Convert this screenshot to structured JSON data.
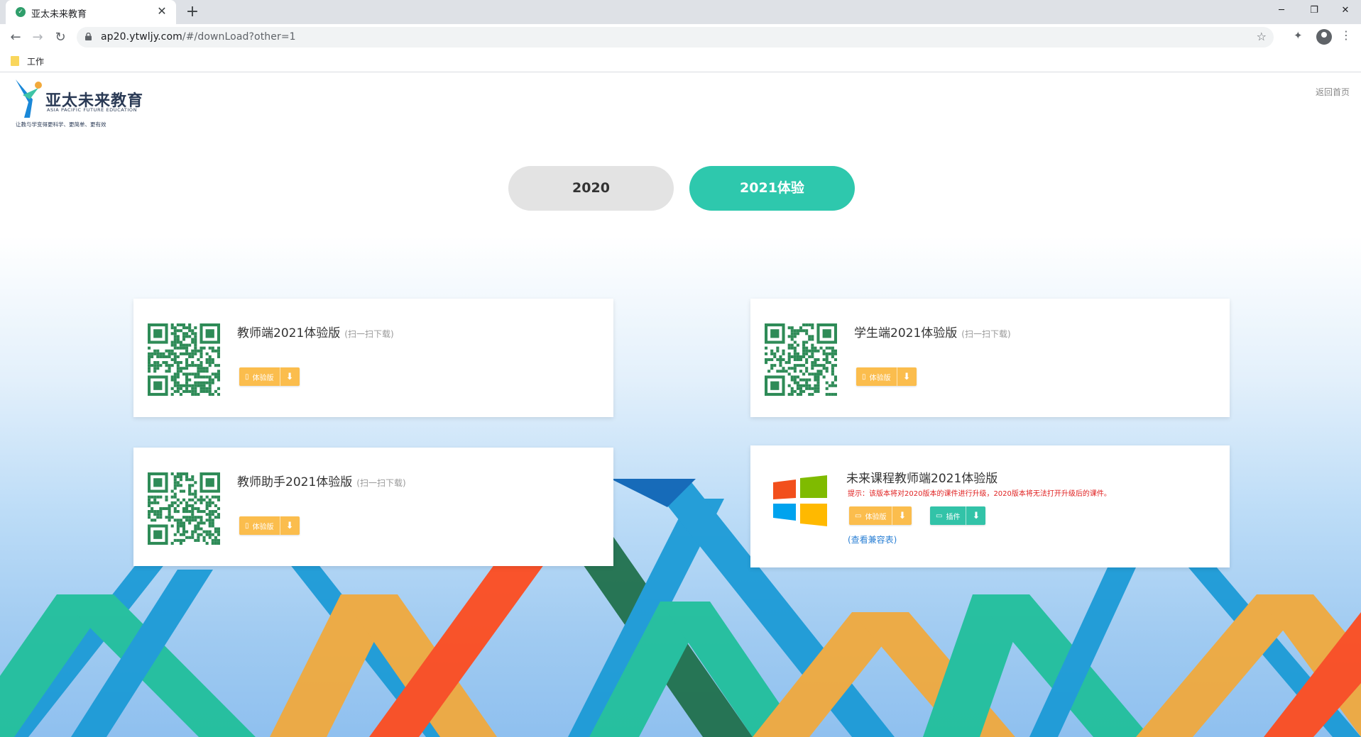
{
  "browser": {
    "tab_title": "亚太未来教育",
    "tab_close": "✕",
    "new_tab": "+",
    "url_host": "ap20.ytwljy.com",
    "url_path": "/#/downLoad?other=1",
    "bookmark_folder": "工作",
    "window_controls": {
      "minimize": "─",
      "restore": "❐",
      "close": "✕"
    }
  },
  "header": {
    "logo_cn": "亚太未来教育",
    "logo_en": "ASIA PACIFIC FUTURE EDUCATION",
    "logo_slogan": "让教与学变得更科学、更简单、更有效",
    "back_home": "返回首页"
  },
  "year_tabs": [
    {
      "label": "2020",
      "active": false
    },
    {
      "label": "2021体验",
      "active": true
    }
  ],
  "cards": {
    "teacher": {
      "title": "教师端2021体验版",
      "hint": "(扫一扫下载)",
      "button": "体验版"
    },
    "student": {
      "title": "学生端2021体验版",
      "hint": "(扫一扫下载)",
      "button": "体验版"
    },
    "assistant": {
      "title": "教师助手2021体验版",
      "hint": "(扫一扫下载)",
      "button": "体验版"
    },
    "desktop": {
      "title": "未来课程教师端2021体验版",
      "notice": "提示：该版本将对2020版本的课件进行升级，2020版本将无法打开升级后的课件。",
      "button_trial": "体验版",
      "button_plugin": "插件",
      "compat_link": "(查看兼容表)"
    }
  },
  "colors": {
    "accent_teal": "#2ec8ad",
    "button_yellow": "#fbbd4d",
    "qr_green": "#2e8b57",
    "notice_red": "#e02020",
    "link_blue": "#2a7fd4"
  }
}
